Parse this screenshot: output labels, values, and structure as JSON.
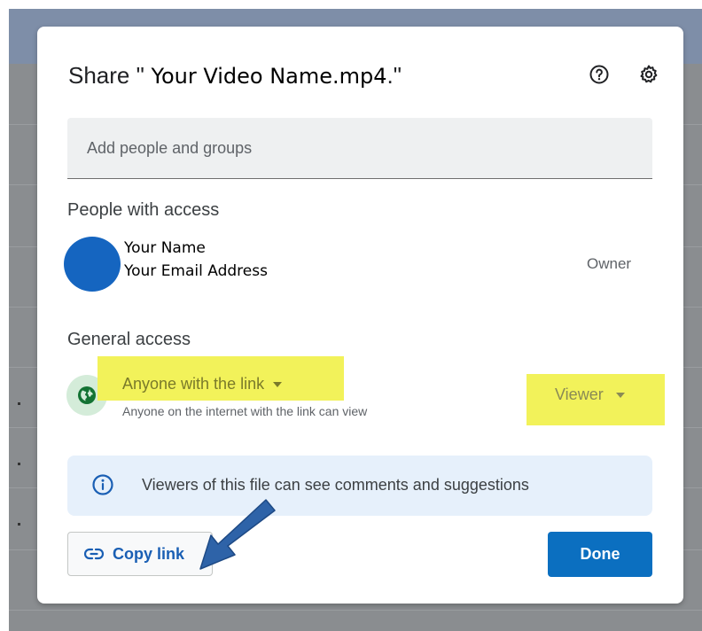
{
  "dialog": {
    "title_prefix": "Share \"",
    "title_filename": " Your Video Name.mp4",
    "title_suffix": ".\"",
    "help_icon": "help-circle-icon",
    "settings_icon": "gear-icon"
  },
  "add_people": {
    "placeholder": "Add people and groups"
  },
  "people_section": {
    "heading": "People with access",
    "people": [
      {
        "name": "Your Name",
        "email": "Your Email Address",
        "role": "Owner"
      }
    ]
  },
  "general_access": {
    "heading": "General access",
    "access_label": "Anyone with the link",
    "access_description": "Anyone on the internet with the link can view",
    "role_label": "Viewer",
    "highlight_color": "#f2f25a",
    "globe_icon": "globe-icon"
  },
  "info": {
    "text": "Viewers of this file can see comments and suggestions",
    "icon": "info-icon"
  },
  "actions": {
    "copy_link_label": "Copy link",
    "copy_link_icon": "link-icon",
    "done_label": "Done",
    "accent": "#0b6fc0"
  },
  "annotation": {
    "arrow_color": "#2e63a8"
  }
}
